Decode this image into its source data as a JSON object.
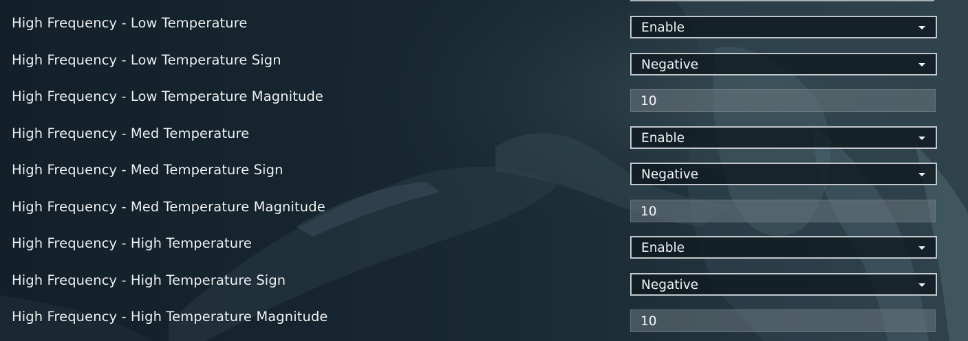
{
  "theme": {
    "label_color": "#eef2f4",
    "select_border": "#c3c9cc",
    "select_bg": "#0e181f",
    "number_bg": "#6e7a80",
    "page_bg": "#16222b"
  },
  "settings": {
    "rows": [
      {
        "label": "High Frequency - Low Temperature",
        "control": "select",
        "value": "Enable",
        "icon": "chevron-down-icon"
      },
      {
        "label": "High Frequency - Low Temperature Sign",
        "control": "select",
        "value": "Negative",
        "icon": "chevron-down-icon"
      },
      {
        "label": "High Frequency - Low Temperature Magnitude",
        "control": "number",
        "value": "10"
      },
      {
        "label": "High Frequency - Med Temperature",
        "control": "select",
        "value": "Enable",
        "icon": "chevron-down-icon"
      },
      {
        "label": "High Frequency - Med Temperature Sign",
        "control": "select",
        "value": "Negative",
        "icon": "chevron-down-icon"
      },
      {
        "label": "High Frequency - Med Temperature Magnitude",
        "control": "number",
        "value": "10"
      },
      {
        "label": "High Frequency - High Temperature",
        "control": "select",
        "value": "Enable",
        "icon": "chevron-down-icon"
      },
      {
        "label": "High Frequency - High Temperature Sign",
        "control": "select",
        "value": "Negative",
        "icon": "chevron-down-icon"
      },
      {
        "label": "High Frequency - High Temperature Magnitude",
        "control": "number",
        "value": "10"
      }
    ]
  }
}
